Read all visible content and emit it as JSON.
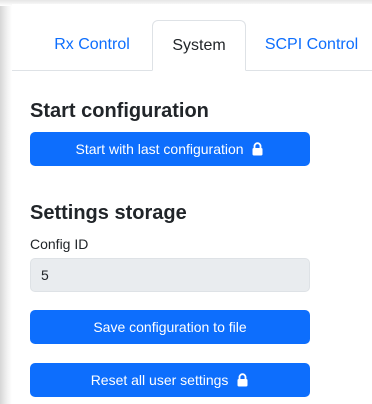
{
  "tabs": [
    {
      "label": "Rx Control",
      "active": false
    },
    {
      "label": "System",
      "active": true
    },
    {
      "label": "SCPI Control",
      "active": false
    }
  ],
  "start": {
    "heading": "Start configuration",
    "button_label": "Start with last configuration",
    "button_icon": "lock-icon"
  },
  "storage": {
    "heading": "Settings storage",
    "config_id_label": "Config ID",
    "config_id_value": "5",
    "save_label": "Save configuration to file",
    "reset_label": "Reset all user settings",
    "reset_icon": "lock-icon"
  },
  "colors": {
    "primary": "#0d6efd",
    "readonly_field": "#e9ecef"
  }
}
